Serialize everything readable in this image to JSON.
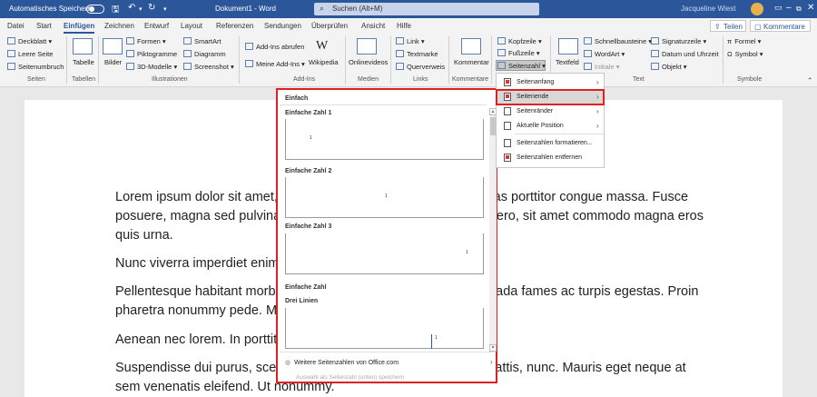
{
  "titlebar": {
    "autosave": "Automatisches Speichern",
    "doc_title": "Dokument1 - Word",
    "search": "Suchen (Alt+M)",
    "user": "Jacqueline Wiest",
    "share": "Teilen",
    "comments": "Kommentare"
  },
  "tabs": [
    "Datei",
    "Start",
    "Einfügen",
    "Zeichnen",
    "Entwurf",
    "Layout",
    "Referenzen",
    "Sendungen",
    "Überprüfen",
    "Ansicht",
    "Hilfe"
  ],
  "active_tab": "Einfügen",
  "ribbon": {
    "seiten": {
      "items": [
        "Deckblatt",
        "Leere Seite",
        "Seitenumbruch"
      ],
      "label": "Seiten"
    },
    "tabellen": {
      "button": "Tabelle",
      "label": "Tabellen"
    },
    "illustrationen": {
      "bilder": "Bilder",
      "items": [
        "Formen",
        "Piktogramme",
        "3D-Modelle"
      ],
      "items2": [
        "SmartArt",
        "Diagramm",
        "Screenshot"
      ],
      "label": "Illustrationen"
    },
    "addins": {
      "items": [
        "Add-Ins abrufen",
        "Meine Add-Ins"
      ],
      "wikipedia": "Wikipedia",
      "label": "Add-Ins"
    },
    "medien": {
      "button": "Onlinevideos",
      "label": "Medien"
    },
    "links": {
      "items": [
        "Link",
        "Textmarke",
        "Querverweis"
      ],
      "label": "Links"
    },
    "kommentare": {
      "button": "Kommentar",
      "label": "Kommentare"
    },
    "kopfzeile": {
      "items": [
        "Kopfzeile",
        "Fußzeile",
        "Seitenzahl"
      ]
    },
    "text": {
      "textfeld": "Textfeld",
      "items": [
        "Schnellbausteine",
        "WordArt",
        "Initiale"
      ],
      "items2": [
        "Signaturzeile",
        "Datum und Uhrzeit",
        "Objekt"
      ],
      "label": "Text"
    },
    "symbole": {
      "items": [
        "Formel",
        "Symbol"
      ],
      "label": "Symbole"
    }
  },
  "document": {
    "paragraphs": [
      "Lorem ipsum dolor sit amet, consectetuer adipiscing elit. Maecenas porttitor congue massa. Fusce posuere, magna sed pulvinar ultricies, purus lectus malesuada libero, sit amet commodo magna eros quis urna.",
      "Nunc viverra imperdiet enim. Fusce est. Vivamus a tellus.",
      "Pellentesque habitant morbi tristique senectus et netus et malesuada fames ac turpis egestas. Proin pharetra nonummy pede. Mauris et orci.",
      "Aenean nec lorem. In porttitor. Donec laoreet nonummy augue.",
      "Suspendisse dui purus, scelerisque at, vulputate vitae, pretium mattis, nunc. Mauris eget neque at sem venenatis eleifend. Ut nonummy."
    ]
  },
  "gallery": {
    "header": "Einfach",
    "items": [
      {
        "name": "Einfache Zahl 1",
        "num": "1"
      },
      {
        "name": "Einfache Zahl 2",
        "num": "1"
      },
      {
        "name": "Einfache Zahl 3",
        "num": "1"
      }
    ],
    "group2": "Einfache Zahl",
    "item4": {
      "name": "Drei Linien",
      "num": "1"
    },
    "more": "Weitere Seitenzahlen von Office.com",
    "save": "Auswahl als Seitenzahl (unten) speichern"
  },
  "menu": {
    "items": [
      "Seitenanfang",
      "Seitenende",
      "Seitenränder",
      "Aktuelle Position",
      "Seitenzahlen formatieren...",
      "Seitenzahlen entfernen"
    ]
  }
}
